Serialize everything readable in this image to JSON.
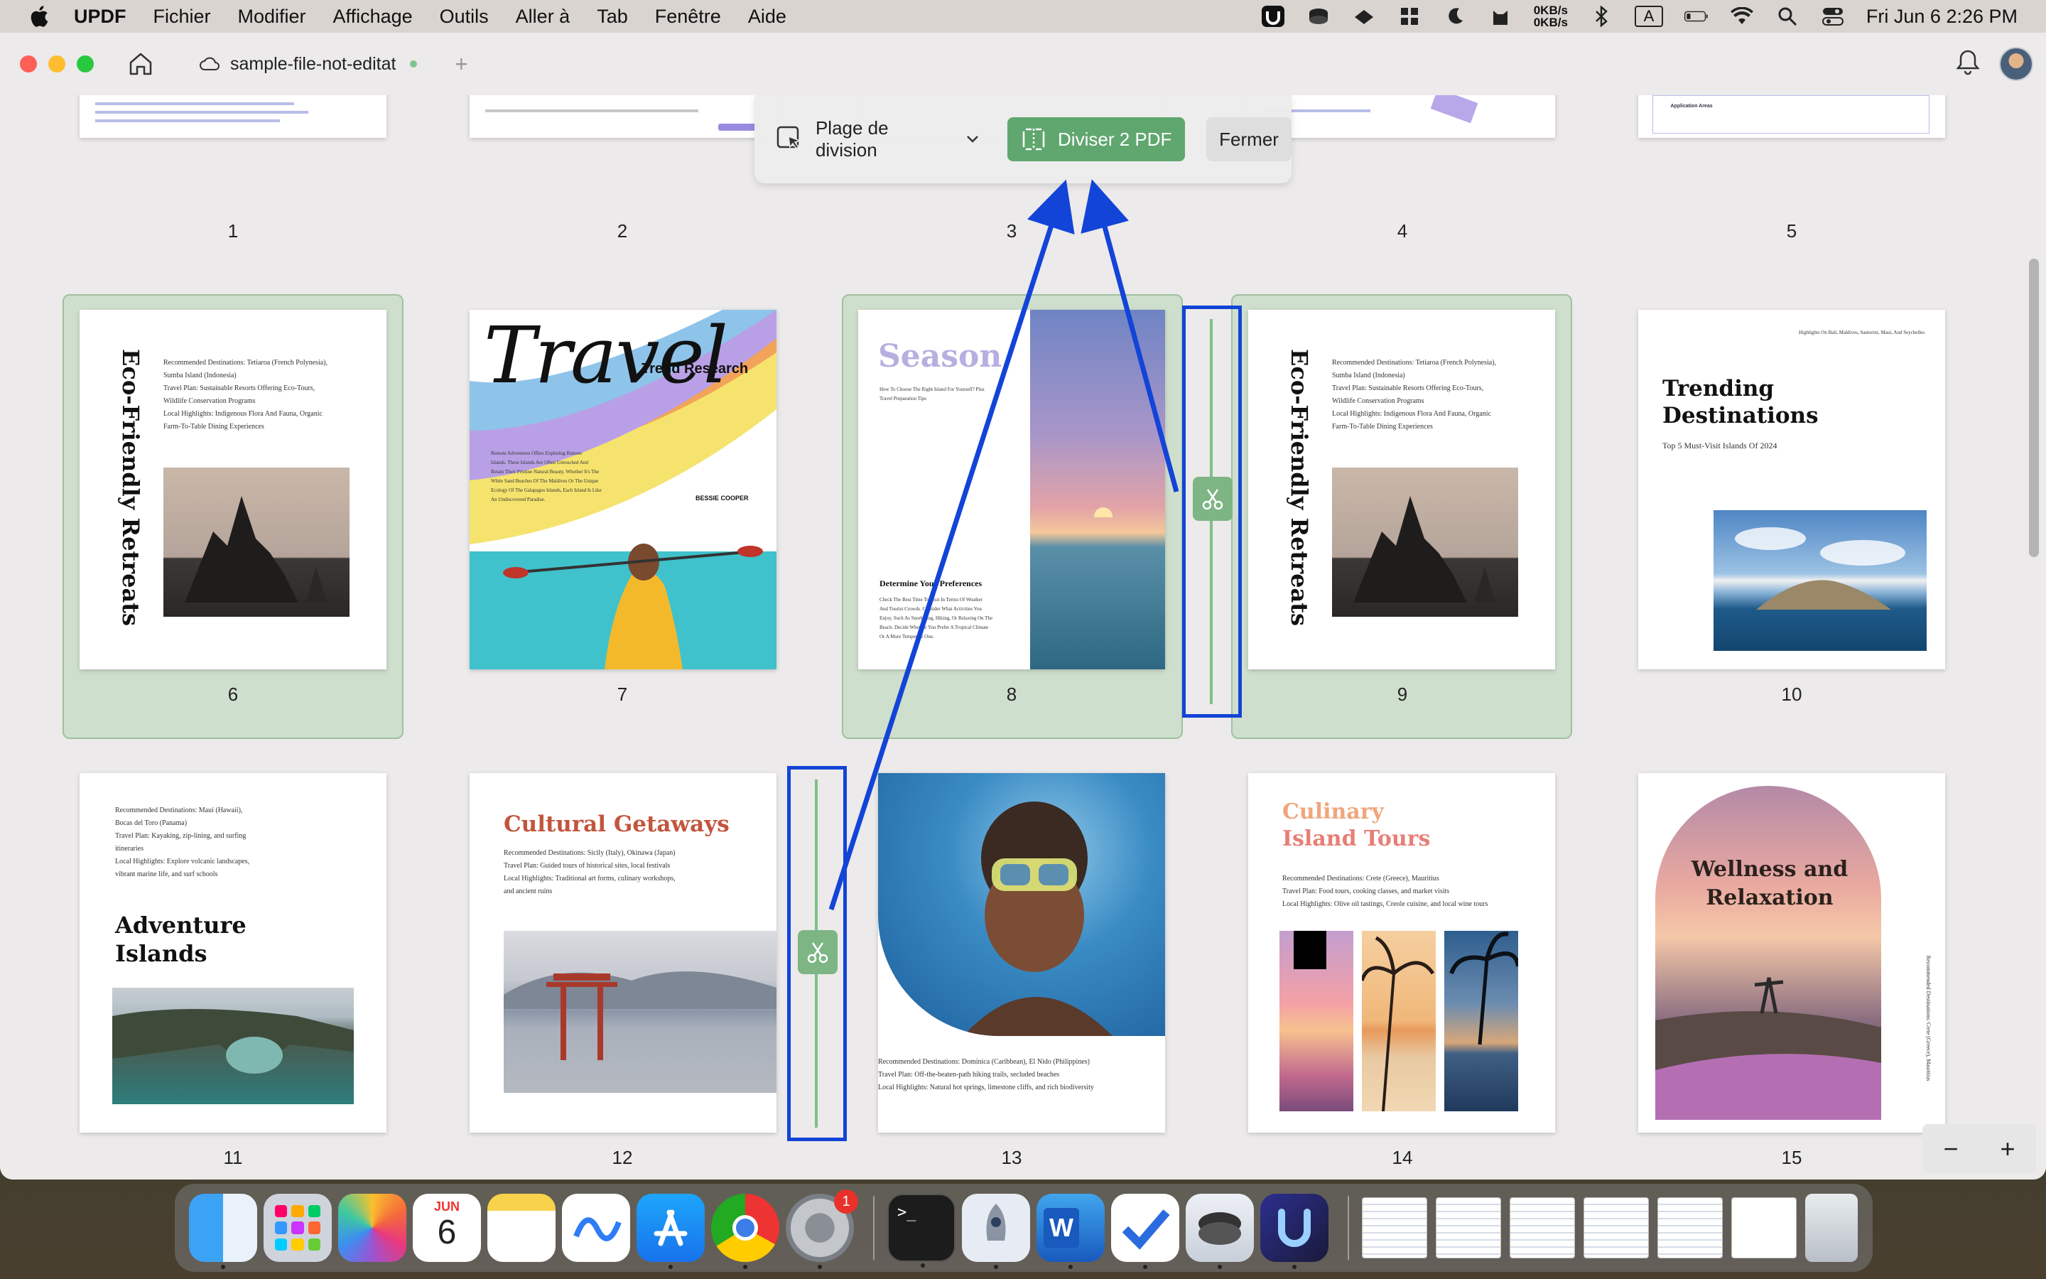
{
  "menubar": {
    "app_name": "UPDF",
    "menus": [
      "Fichier",
      "Modifier",
      "Affichage",
      "Outils",
      "Aller à",
      "Tab",
      "Fenêtre",
      "Aide"
    ],
    "net_up": "0KB/s",
    "net_down": "0KB/s",
    "input_source": "A",
    "clock": "Fri Jun 6  2:26 PM"
  },
  "tab": {
    "title": "sample-file-not-editat",
    "add": "+"
  },
  "split_toolbar": {
    "range_label": "Plage de division",
    "split_label": "Diviser 2 PDF",
    "close_label": "Fermer"
  },
  "page_numbers": [
    "1",
    "2",
    "3",
    "4",
    "5",
    "6",
    "7",
    "8",
    "9",
    "10",
    "11",
    "12",
    "13",
    "14",
    "15"
  ],
  "pages": {
    "p1_top": "Application Areas",
    "p6": {
      "title": "Eco-Friendly Retreats",
      "lines": [
        "Recommended Destinations: Tetiaroa (French Polynesia),",
        "Sumba Island (Indonesia)",
        "Travel Plan: Sustainable Resorts Offering Eco-Tours,",
        "Wildlife Conservation Programs",
        "Local Highlights: Indigenous Flora And Fauna, Organic",
        "Farm-To-Table Dining Experiences"
      ]
    },
    "p7": {
      "script_title": "Travel",
      "subtitle": "Trend Research",
      "author": "BESSIE COOPER",
      "lines": [
        "Remote Adventures Offers Exploring Remote",
        "Islands. These Islands Are Often Untouched And",
        "Retain Their Pristine Natural Beauty. Whether It's The",
        "White Sand Beaches Of The Maldives Or The Unique",
        "Ecology Of The Galapagos Islands, Each Island Is Like",
        "An Undiscovered Paradise."
      ]
    },
    "p8": {
      "title": "Season",
      "intro": [
        "How To Choose The Right Island For Yourself? Plus",
        "Travel Preparation Tips"
      ],
      "heading": "Determine Your Preferences",
      "lines": [
        "Check The Best Time To Visit In Terms Of Weather",
        "And Tourist Crowds. Consider What Activities You",
        "Enjoy, Such As Snorkeling, Hiking, Or Relaxing On The",
        "Beach. Decide Whether You Prefer A Tropical Climate",
        "Or A More Temperate One."
      ]
    },
    "p9": {
      "title": "Eco-Friendly Retreats",
      "lines": [
        "Recommended Destinations: Tetiaroa (French Polynesia),",
        "Sumba Island (Indonesia)",
        "Travel Plan: Sustainable Resorts Offering Eco-Tours,",
        "Wildlife Conservation Programs",
        "Local Highlights: Indigenous Flora And Fauna, Organic",
        "Farm-To-Table Dining Experiences"
      ]
    },
    "p10": {
      "corner": "Highlights On Bali, Maldives, Santorini, Maui, And Seychelles",
      "title_line1": "Trending",
      "title_line2": "Destinations",
      "subtitle": "Top 5 Must-Visit Islands Of 2024"
    },
    "p11": {
      "lines": [
        "Recommended Destinations: Maui (Hawaii),",
        "Bocas del Toro (Panama)",
        "Travel Plan: Kayaking, zip-lining, and surfing",
        "itineraries",
        "Local Highlights: Explore volcanic landscapes,",
        "vibrant marine life, and surf schools"
      ],
      "title_line1": "Adventure",
      "title_line2": "Islands"
    },
    "p12": {
      "title": "Cultural Getaways",
      "lines": [
        "Recommended Destinations: Sicily (Italy), Okinawa (Japan)",
        "Travel Plan: Guided tours of historical sites, local festivals",
        "Local Highlights: Traditional art forms, culinary workshops,",
        "and ancient ruins"
      ]
    },
    "p13": {
      "lines": [
        "Recommended Destinations: Dominica (Caribbean), El Nido (Philippines)",
        "Travel Plan: Off-the-beaten-path hiking trails, secluded beaches",
        "Local Highlights: Natural hot springs, limestone cliffs, and rich biodiversity"
      ]
    },
    "p14": {
      "title_line1": "Culinary",
      "title_line2": "Island Tours",
      "lines": [
        "Recommended Destinations: Crete (Greece), Mauritius",
        "Travel Plan: Food tours, cooking classes, and market visits",
        "Local Highlights: Olive oil tastings, Creole cuisine, and local wine tours"
      ]
    },
    "p15": {
      "title_line1": "Wellness and",
      "title_line2": "Relaxation",
      "side": "Recommended Destinations: Crete (Greece), Mauritius"
    }
  },
  "zoom": {
    "minus": "−",
    "plus": "+"
  },
  "dock": {
    "calendar_month": "JUN",
    "calendar_day": "6",
    "settings_badge": "1"
  },
  "colors": {
    "accent_green": "#60a76f",
    "highlight_blue": "#1344d8",
    "group_bg": "#cfdfcd"
  }
}
